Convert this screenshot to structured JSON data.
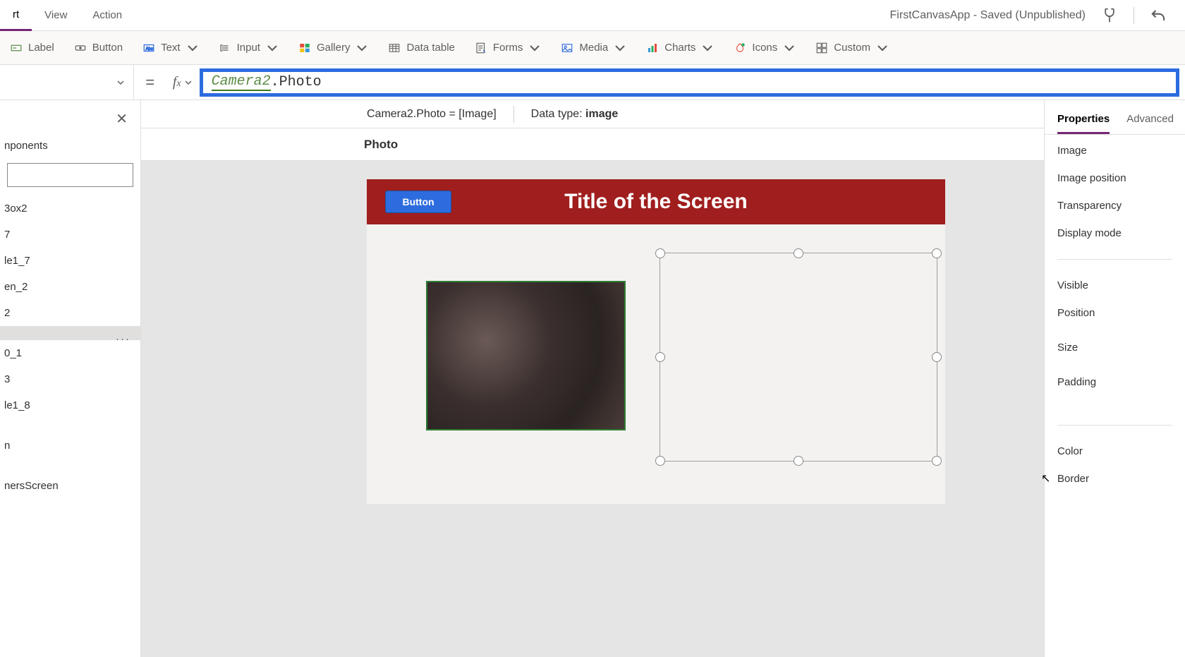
{
  "menubar": {
    "tabs": [
      "rt",
      "View",
      "Action"
    ],
    "activeIndex": 0,
    "status": "FirstCanvasApp - Saved (Unpublished)"
  },
  "ribbon": {
    "label": "Label",
    "button": "Button",
    "text": "Text",
    "input": "Input",
    "gallery": "Gallery",
    "datatable": "Data table",
    "forms": "Forms",
    "media": "Media",
    "charts": "Charts",
    "icons": "Icons",
    "custom": "Custom"
  },
  "formula": {
    "ident": "Camera2",
    "rest": ".Photo",
    "result_expr": "Camera2.Photo",
    "result_eq": " = ",
    "result_val": "[Image]",
    "datatype_label": "Data type: ",
    "datatype_value": "image",
    "property_name": "Photo"
  },
  "leftpane": {
    "tabhead": "nponents",
    "tree": [
      "3ox2",
      "7",
      "le1_7",
      "en_2",
      "2",
      "",
      "0_1",
      "3",
      "le1_8",
      "",
      "n",
      "",
      "nersScreen"
    ],
    "selectedIndex": 5
  },
  "canvas": {
    "title": "Title of the Screen",
    "button": "Button"
  },
  "rightpane": {
    "tabs": [
      "Properties",
      "Advanced"
    ],
    "activeTab": 0,
    "group1": [
      "Image",
      "Image position",
      "Transparency",
      "Display mode"
    ],
    "group2": [
      "Visible",
      "Position",
      "Size",
      "Padding"
    ],
    "group3": [
      "Color",
      "Border"
    ]
  }
}
